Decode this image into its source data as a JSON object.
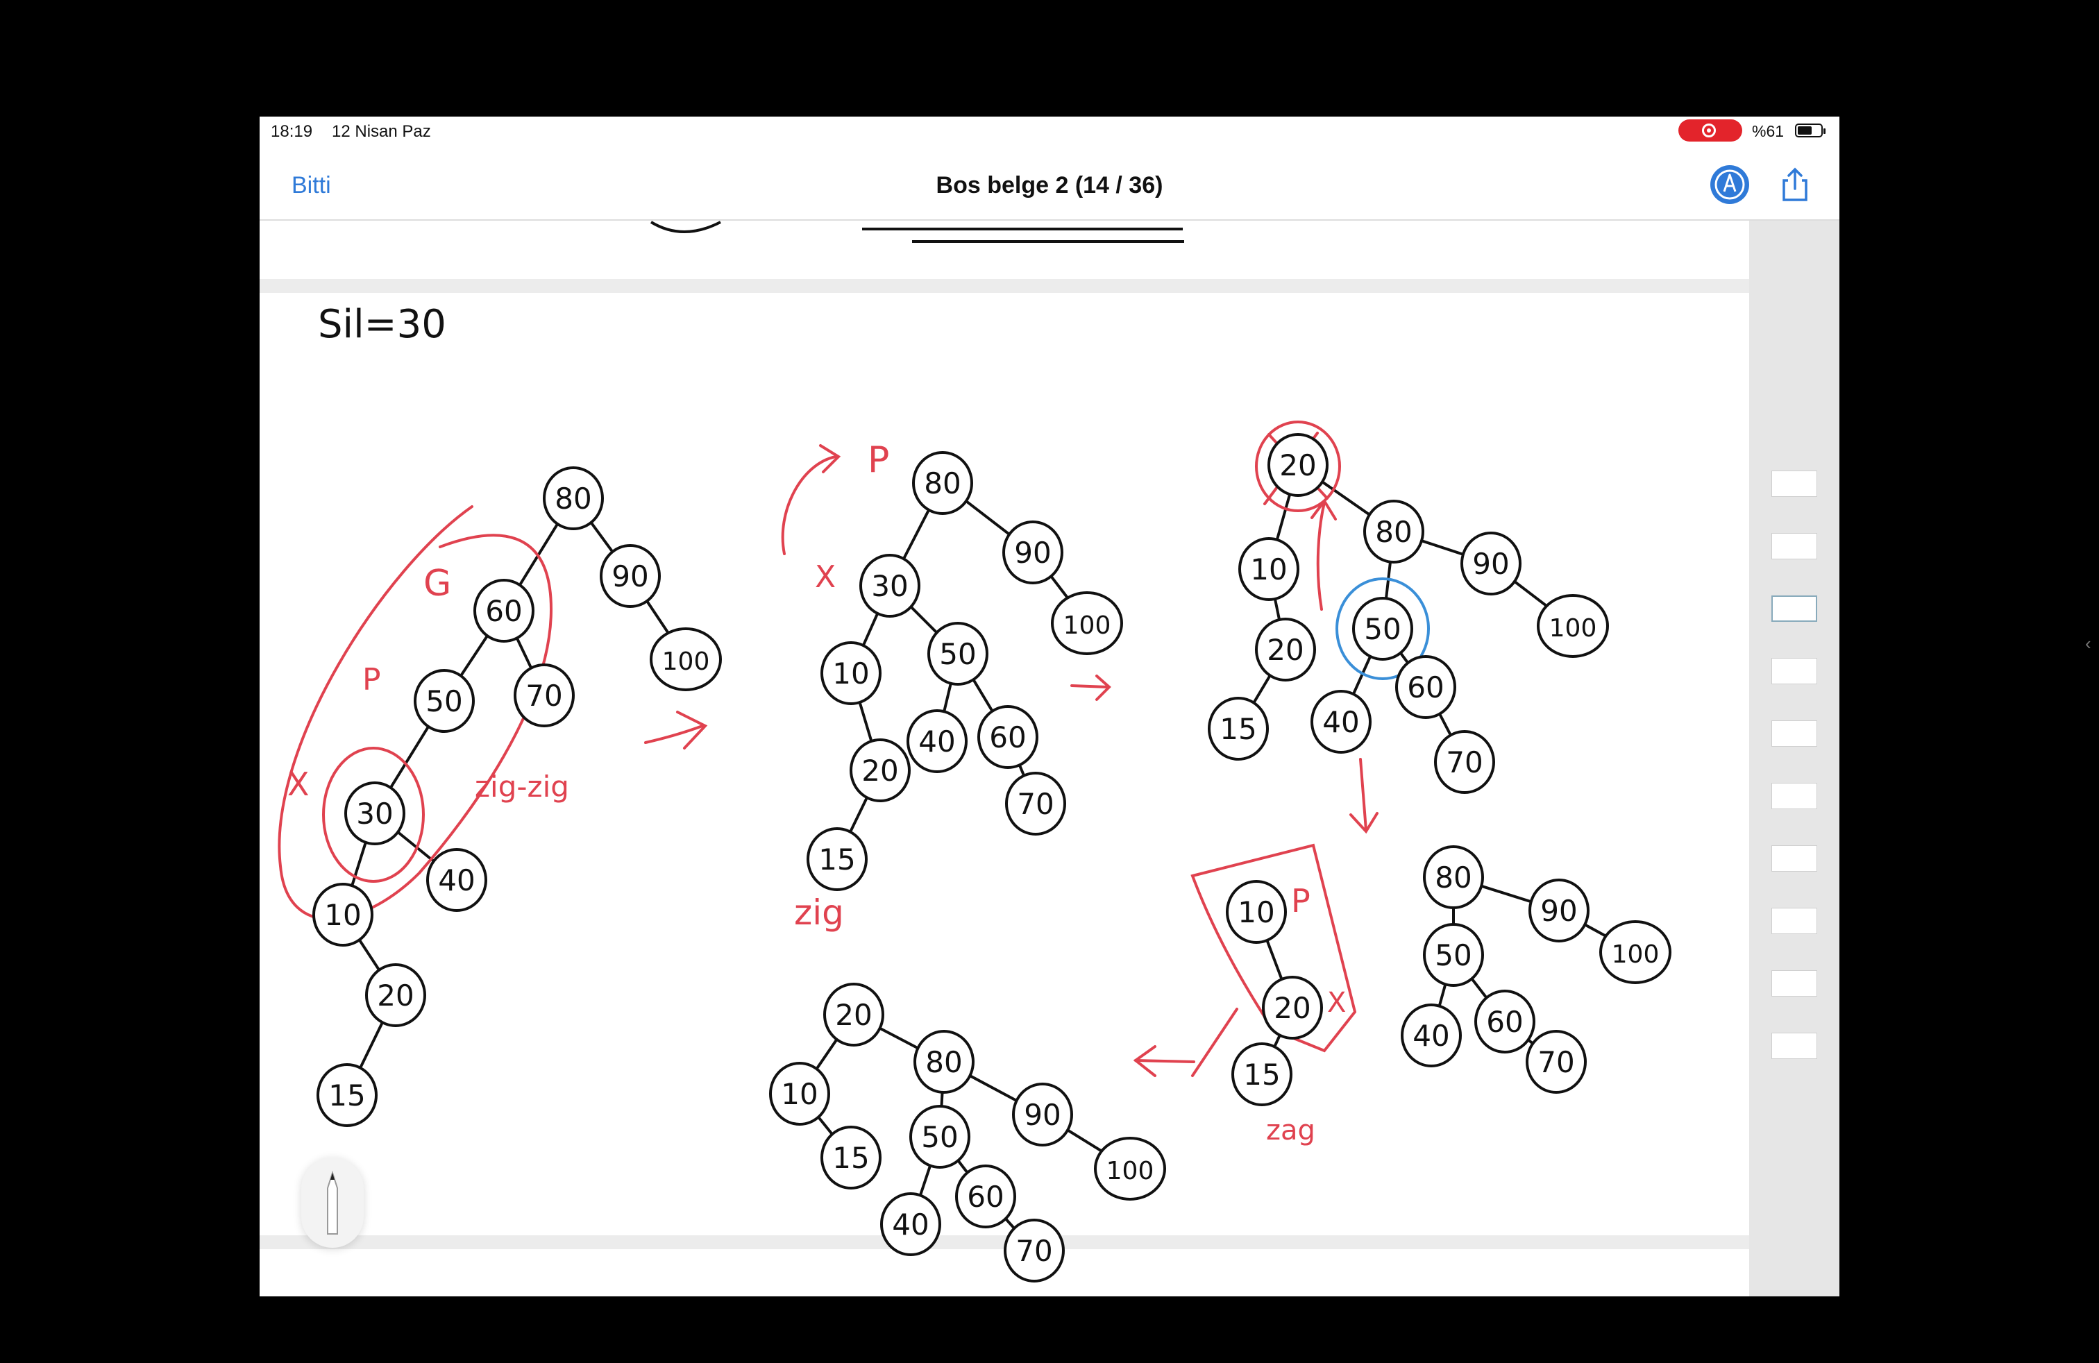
{
  "status_bar": {
    "time": "18:19",
    "date": "12 Nisan Paz",
    "battery_percent": "%61",
    "battery_level": 0.61
  },
  "nav": {
    "done_label": "Bitti",
    "title": "Bos belge 2 (14 / 36)"
  },
  "icons": {
    "markup": "markup-pen-icon",
    "share": "share-icon",
    "pencil": "pencil-tool-icon",
    "chevron": "chevron-left-icon"
  },
  "colors": {
    "ink": "#111111",
    "red_ink": "#e0424f",
    "blue_ink": "#3a8fd8",
    "accent": "#2f7ad8",
    "record": "#e3242b"
  },
  "notes": {
    "heading": "Sil=30",
    "tree1": {
      "nodes": [
        "80",
        "60",
        "90",
        "100",
        "50",
        "70",
        "30",
        "40",
        "10",
        "20",
        "15"
      ],
      "labels": [
        "G",
        "P",
        "X",
        "zig-zig"
      ]
    },
    "tree2": {
      "nodes": [
        "80",
        "30",
        "90",
        "100",
        "10",
        "50",
        "20",
        "40",
        "60",
        "70",
        "15"
      ],
      "labels": [
        "P",
        "X",
        "zig"
      ]
    },
    "tree3": {
      "nodes": [
        "20",
        "80",
        "10",
        "90",
        "100",
        "20",
        "50",
        "15",
        "40",
        "60",
        "70"
      ]
    },
    "tree4": {
      "nodes": [
        "10",
        "80",
        "90",
        "100",
        "20",
        "50",
        "15",
        "40",
        "60",
        "70"
      ],
      "labels": [
        "P",
        "X",
        "zag"
      ]
    },
    "tree5": {
      "nodes": [
        "20",
        "80",
        "10",
        "90",
        "100",
        "15",
        "50",
        "40",
        "60",
        "70"
      ]
    }
  },
  "sidebar": {
    "thumbnail_count": 10,
    "active_index": 2
  }
}
